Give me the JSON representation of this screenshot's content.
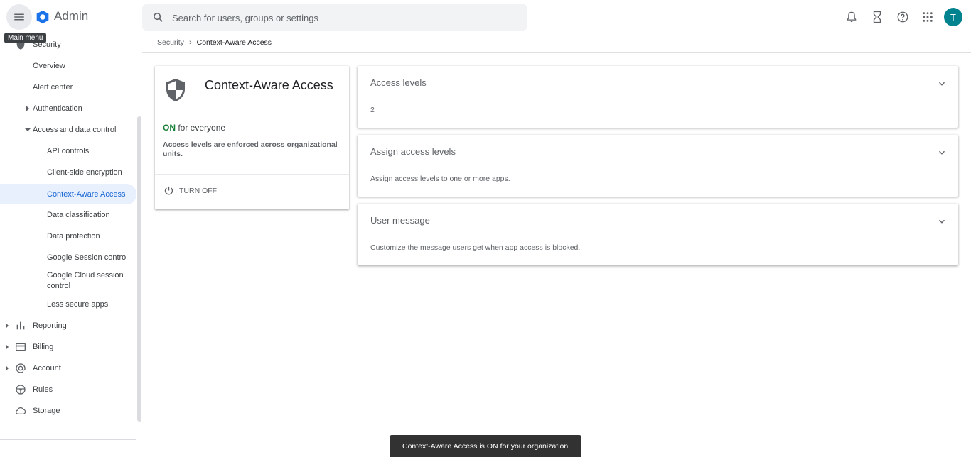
{
  "app": {
    "title": "Admin"
  },
  "topbar": {
    "menu_tooltip": "Main menu",
    "search_placeholder": "Search for users, groups or settings",
    "avatar_initial": "T",
    "icons": [
      "notifications-icon",
      "hourglass-icon",
      "help-icon",
      "apps-grid-icon"
    ]
  },
  "sidebar": {
    "security": "Security",
    "overview": "Overview",
    "alert_center": "Alert center",
    "authentication": "Authentication",
    "access_data_control": "Access and data control",
    "api_controls": "API controls",
    "client_side_encryption": "Client-side encryption",
    "context_aware_access": "Context-Aware Access",
    "data_classification": "Data classification",
    "data_protection": "Data protection",
    "google_session_control": "Google Session control",
    "google_cloud_session_control": "Google Cloud session control",
    "less_secure_apps": "Less secure apps",
    "reporting": "Reporting",
    "billing": "Billing",
    "account": "Account",
    "rules": "Rules",
    "storage": "Storage"
  },
  "breadcrumb": {
    "parent": "Security",
    "current": "Context-Aware Access"
  },
  "status_card": {
    "title": "Context-Aware Access",
    "status_on": "ON",
    "status_rest": " for everyone",
    "description": "Access levels are enforced across organizational units.",
    "turn_off_label": "TURN OFF"
  },
  "panels": [
    {
      "title": "Access levels",
      "body": "2"
    },
    {
      "title": "Assign access levels",
      "body": "Assign access levels to one or more apps."
    },
    {
      "title": "User message",
      "body": "Customize the message users get when app access is blocked."
    }
  ],
  "snackbar": {
    "message": "Context-Aware Access is ON for your organization."
  },
  "colors": {
    "accent": "#1967d2",
    "on_status": "#188038",
    "avatar": "#00838f",
    "selected_bg": "#e8f0fe"
  }
}
